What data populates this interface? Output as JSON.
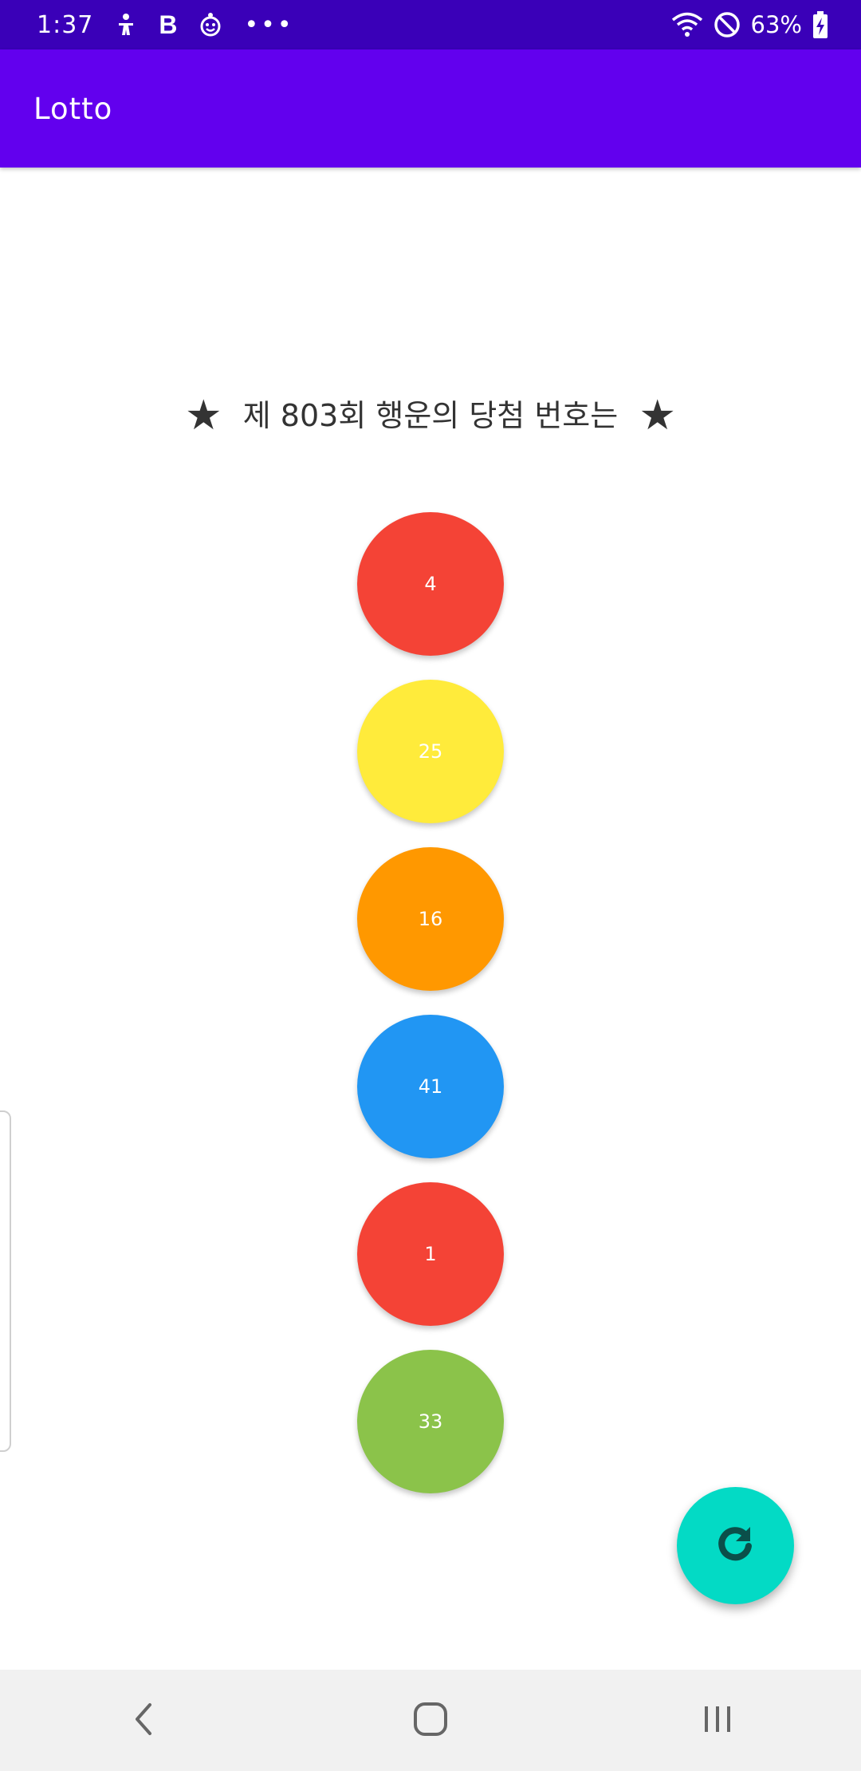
{
  "status_bar": {
    "time": "1:37",
    "icons": [
      "accessibility-icon",
      "b-app-icon",
      "smiley-app-icon",
      "more-notifications-icon"
    ],
    "b_label": "B",
    "more_label": "•••",
    "battery": "63%",
    "right_icons": [
      "wifi-icon",
      "do-not-disturb-icon",
      "battery-charging-icon"
    ]
  },
  "app_bar": {
    "title": "Lotto"
  },
  "headline": {
    "star": "★",
    "text": "제 803회 행운의 당첨 번호는"
  },
  "balls": [
    {
      "number": "4",
      "color": "#f44336"
    },
    {
      "number": "25",
      "color": "#ffeb3b"
    },
    {
      "number": "16",
      "color": "#ff9800"
    },
    {
      "number": "41",
      "color": "#2196f3"
    },
    {
      "number": "1",
      "color": "#f44336"
    },
    {
      "number": "33",
      "color": "#8bc34a"
    }
  ],
  "fab": {
    "icon": "refresh-icon",
    "color": "#03dac5"
  },
  "nav_bar": {
    "buttons": [
      "back-icon",
      "home-icon",
      "recent-apps-icon"
    ]
  },
  "colors": {
    "status_bar": "#3a00b8",
    "app_bar": "#6200ee"
  }
}
